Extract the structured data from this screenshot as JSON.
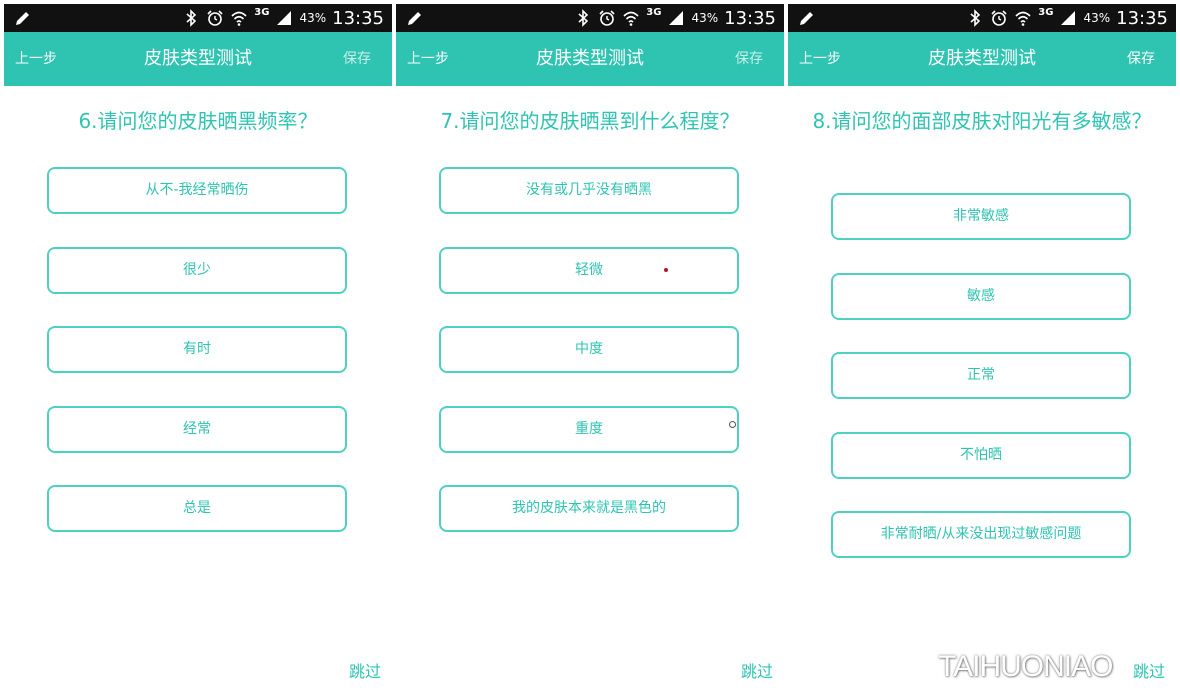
{
  "status": {
    "battery": "43%",
    "time": "13:35",
    "network": "3G"
  },
  "colors": {
    "accent": "#2fc4b2",
    "statusbar": "#111111",
    "option_border": "#4fd1c1"
  },
  "icons": [
    "edit-icon",
    "bluetooth-icon",
    "alarm-icon",
    "wifi-icon",
    "signal-icon"
  ],
  "screens": [
    {
      "back_label": "上一步",
      "title": "皮肤类型测试",
      "save_label": "保存",
      "save_enabled": false,
      "question": "6.请问您的皮肤晒黑频率？",
      "options": [
        "从不-我经常晒伤",
        "很少",
        "有时",
        "经常",
        "总是"
      ],
      "skip_label": "跳过"
    },
    {
      "back_label": "上一步",
      "title": "皮肤类型测试",
      "save_label": "保存",
      "save_enabled": false,
      "question": "7.请问您的皮肤晒黑到什么程度？",
      "options": [
        "没有或几乎没有晒黑",
        "轻微",
        "中度",
        "重度",
        "我的皮肤本来就是黑色的"
      ],
      "skip_label": "跳过"
    },
    {
      "back_label": "上一步",
      "title": "皮肤类型测试",
      "save_label": "保存",
      "save_enabled": true,
      "question": "8.请问您的面部皮肤对阳光有多敏感？",
      "options": [
        "非常敏感",
        "敏感",
        "正常",
        "不怕晒",
        "非常耐晒/从来没出现过敏感问题"
      ],
      "skip_label": "跳过"
    }
  ],
  "watermark": "TAIHUONIAO"
}
